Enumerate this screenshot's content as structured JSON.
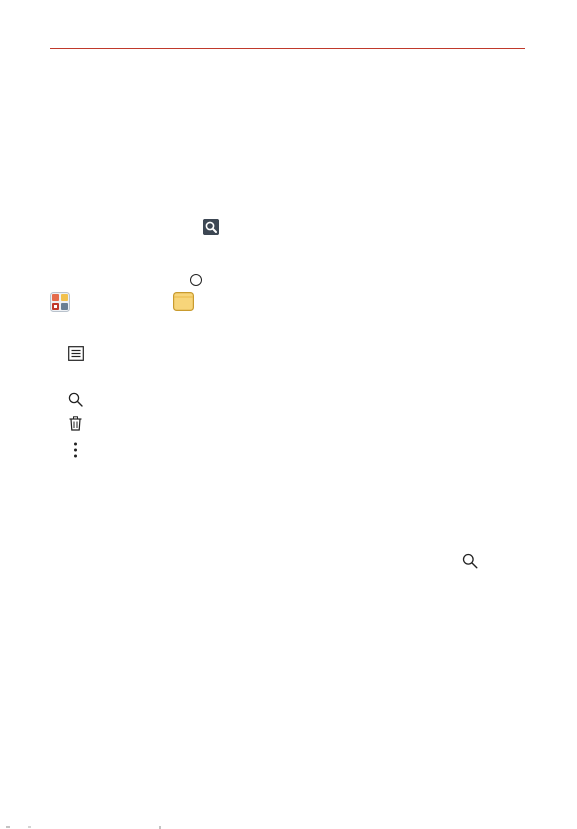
{
  "document": {
    "accent_color": "#c0392b",
    "icons": [
      "search-badge-icon",
      "home-circle-icon",
      "tools-app-icon",
      "file-app-icon",
      "list-menu-icon",
      "search-icon",
      "trash-icon",
      "more-options-icon",
      "search-icon"
    ]
  }
}
